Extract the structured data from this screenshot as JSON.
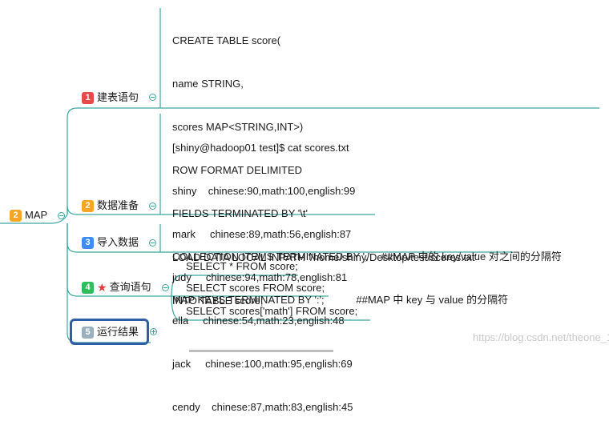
{
  "root": {
    "number": "2",
    "label": "MAP"
  },
  "branches": [
    {
      "number": "1",
      "label": "建表语句",
      "lines": [
        "CREATE TABLE score(",
        "name STRING,",
        "scores MAP<STRING,INT>)",
        "ROW FORMAT DELIMITED",
        "FIELDS TERMINATED BY '\\t'",
        "COLLECTION ITEMS TERMINATED BY ','    ##MAP 中的 key/value 对之间的分隔符",
        "MAP KEYS TERMINATED BY ':';           ##MAP 中 key 与 value 的分隔符"
      ]
    },
    {
      "number": "2",
      "label": "数据准备",
      "lines": [
        "[shiny@hadoop01 test]$ cat scores.txt",
        "shiny    chinese:90,math:100,english:99",
        "mark     chinese:89,math:56,english:87",
        "judy     chinese:94,math:78,english:81",
        "ella     chinese:54,math:23,english:48",
        "jack     chinese:100,math:95,english:69",
        "cendy    chinese:87,math:83,english:45"
      ]
    },
    {
      "number": "3",
      "label": "导入数据",
      "lines": [
        "LOAD DATA LOCAL INPATH '/home/shiny/Desktop/test/scores.txt'",
        "INTO TABLE score;"
      ]
    },
    {
      "number": "4",
      "label": "查询语句",
      "queries": [
        "SELECT * FROM score;",
        "SELECT scores FROM score;",
        "SELECT scores['math'] FROM score;"
      ]
    },
    {
      "number": "5",
      "label": "运行结果"
    }
  ],
  "watermark": "https://blog.csdn.net/theone_1",
  "colors": {
    "branch_line": "#3aa6a0",
    "badge_root": "#f5a623",
    "badge_1": "#e84a4a",
    "badge_2": "#f5a623",
    "badge_3": "#3d8df5",
    "badge_4": "#2ebd59",
    "badge_5": "#9bb0bf",
    "highlight_box": "#2f5ea8"
  }
}
